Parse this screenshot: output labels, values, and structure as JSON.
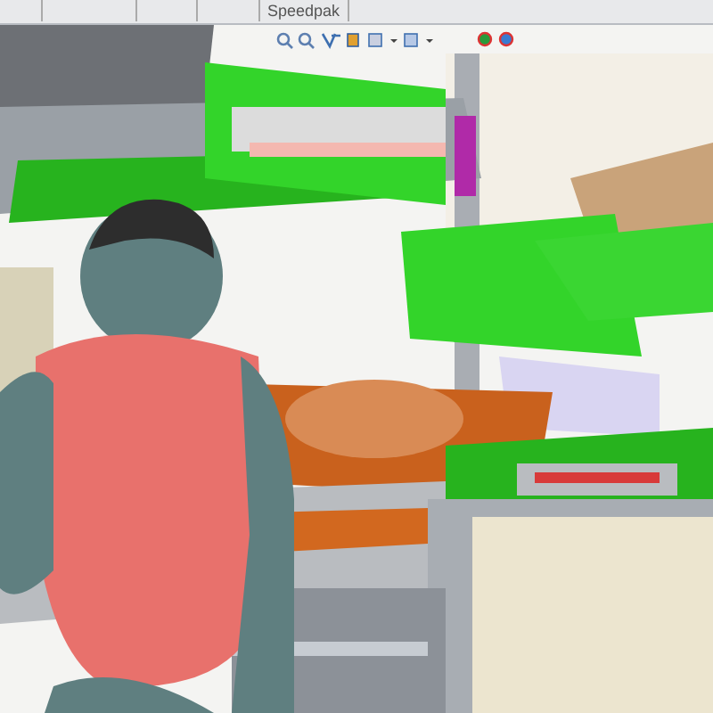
{
  "ribbon": {
    "groups": [
      {
        "label": "Speedpak"
      }
    ]
  }
}
